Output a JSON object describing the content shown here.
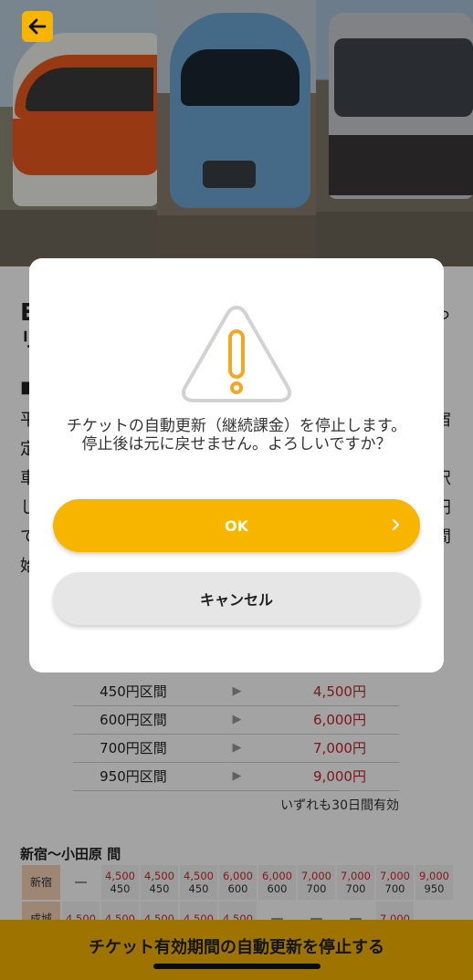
{
  "header": {
    "back_icon": "arrow-left-icon"
  },
  "background": {
    "heading_chars": [
      "E",
      "リ"
    ],
    "heading_right_chars": [
      "っ"
    ],
    "section_marker": "■",
    "body_start_chars": [
      "平",
      "定",
      "車",
      "し",
      "で",
      "始"
    ],
    "body_end_chars": [
      "宿",
      "訳",
      "円",
      "間"
    ],
    "fare_rows": [
      {
        "range": "450円区間",
        "arrow": "▶",
        "price": "4,500円"
      },
      {
        "range": "600円区間",
        "arrow": "▶",
        "price": "6,000円"
      },
      {
        "range": "700円区間",
        "arrow": "▶",
        "price": "7,000円"
      },
      {
        "range": "950円区間",
        "arrow": "▶",
        "price": "9,000円"
      }
    ],
    "validity_note": "いずれも30日間有効",
    "route_title": "新宿〜小田原 間",
    "grid_rows": [
      {
        "station": "新宿",
        "cells": [
          {
            "dash": "—"
          },
          {
            "top": "4,500",
            "bottom": "450"
          },
          {
            "top": "4,500",
            "bottom": "450"
          },
          {
            "top": "4,500",
            "bottom": "450"
          },
          {
            "top": "6,000",
            "bottom": "600"
          },
          {
            "top": "6,000",
            "bottom": "600"
          },
          {
            "top": "7,000",
            "bottom": "700"
          },
          {
            "top": "7,000",
            "bottom": "700"
          },
          {
            "top": "7,000",
            "bottom": "700"
          },
          {
            "top": "9,000",
            "bottom": "950"
          }
        ]
      },
      {
        "station": "成城",
        "cells": [
          {
            "top": "4,500",
            "bottom": ""
          },
          {
            "top": "4,500",
            "bottom": ""
          },
          {
            "top": "4,500",
            "bottom": ""
          },
          {
            "top": "4,500",
            "bottom": ""
          },
          {
            "top": "4,500",
            "bottom": ""
          },
          {
            "dash": "—"
          },
          {
            "dash": "—"
          },
          {
            "dash": "—"
          },
          {
            "top": "7,000",
            "bottom": ""
          }
        ]
      }
    ]
  },
  "bottom_bar": {
    "label": "チケット有効期間の自動更新を停止する"
  },
  "dialog": {
    "icon": "warning-triangle-icon",
    "message": "チケットの自動更新（継続課金）を停止します。停止後は元に戻せません。よろしいですか？",
    "ok_label": "OK",
    "ok_icon": "chevron-right-icon",
    "cancel_label": "キャンセル"
  },
  "colors": {
    "accent": "#f7b500",
    "price_red": "#c0262b",
    "warning_orange": "#f5a623"
  }
}
